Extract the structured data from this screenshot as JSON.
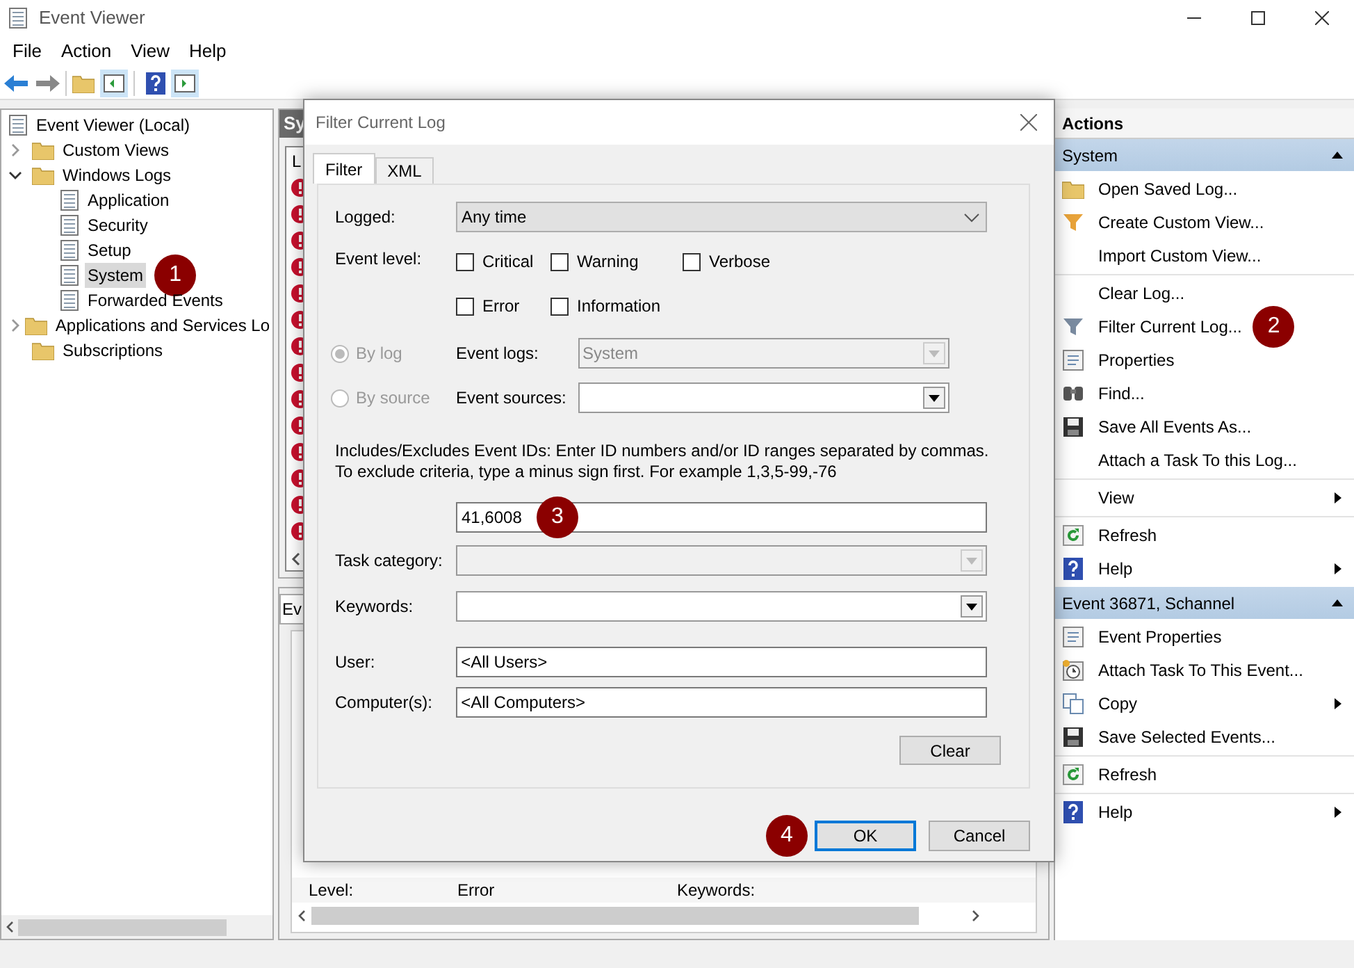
{
  "window": {
    "title": "Event Viewer"
  },
  "menu": [
    "File",
    "Action",
    "View",
    "Help"
  ],
  "tree": [
    {
      "label": "Event Viewer (Local)",
      "selected": false,
      "children": [
        {
          "label": "Custom Views",
          "expanded": false,
          "selected": false
        },
        {
          "label": "Windows Logs",
          "expanded": true,
          "selected": false,
          "children": [
            {
              "label": "Application",
              "selected": false
            },
            {
              "label": "Security",
              "selected": false
            },
            {
              "label": "Setup",
              "selected": false
            },
            {
              "label": "System",
              "selected": true,
              "badge": "1"
            },
            {
              "label": "Forwarded Events",
              "selected": false
            }
          ]
        },
        {
          "label": "Applications and Services Lo",
          "expanded": false,
          "selected": false
        },
        {
          "label": "Subscriptions",
          "selected": false
        }
      ]
    }
  ],
  "middle_pane": {
    "header": "Sy",
    "column_1": "L",
    "tab": "Ev",
    "details": [
      "Level:",
      "Error",
      "Keywords:"
    ]
  },
  "dialog": {
    "title": "Filter Current Log",
    "tabs": [
      {
        "label": "Filter",
        "selected": true
      },
      {
        "label": "XML",
        "selected": false
      }
    ],
    "logged": {
      "label": "Logged:",
      "value": "Any time"
    },
    "event_level": {
      "label": "Event level:",
      "options": [
        {
          "label": "Critical",
          "checked": false
        },
        {
          "label": "Warning",
          "checked": false
        },
        {
          "label": "Verbose",
          "checked": false
        },
        {
          "label": "Error",
          "checked": false
        },
        {
          "label": "Information",
          "checked": false
        }
      ]
    },
    "scope": [
      {
        "label": "By log",
        "selected": true,
        "field_label": "Event logs:",
        "value": "System",
        "disabled": true
      },
      {
        "label": "By source",
        "selected": false,
        "field_label": "Event sources:",
        "disabled": false
      }
    ],
    "hint": "Includes/Excludes Event IDs: Enter ID numbers and/or ID ranges separated by commas. To exclude criteria, type a minus sign first. For example 1,3,5-99,-76",
    "event_ids": {
      "value": "41,6008",
      "badge": "3"
    },
    "task_category": {
      "label": "Task category:",
      "disabled": true
    },
    "keywords": {
      "label": "Keywords:",
      "disabled": false
    },
    "user": {
      "label": "User:",
      "value": "<All Users>"
    },
    "computers": {
      "label": "Computer(s):",
      "value": "<All Computers>"
    },
    "clear_button": "Clear",
    "buttons": [
      {
        "label": "OK",
        "default": true,
        "badge": "4"
      },
      {
        "label": "Cancel",
        "default": false
      }
    ]
  },
  "actions": {
    "title": "Actions",
    "sections": [
      {
        "title": "System",
        "expanded": true,
        "groups": [
          [
            {
              "label": "Open Saved Log...",
              "submenu": false
            },
            {
              "label": "Create Custom View...",
              "submenu": false
            },
            {
              "label": "Import Custom View...",
              "submenu": false
            }
          ],
          [
            {
              "label": "Clear Log...",
              "submenu": false
            },
            {
              "label": "Filter Current Log...",
              "submenu": false,
              "badge": "2"
            },
            {
              "label": "Properties",
              "submenu": false
            },
            {
              "label": "Find...",
              "submenu": false
            },
            {
              "label": "Save All Events As...",
              "submenu": false
            },
            {
              "label": "Attach a Task To this Log...",
              "submenu": false
            }
          ],
          [
            {
              "label": "View",
              "submenu": true
            }
          ],
          [
            {
              "label": "Refresh",
              "submenu": false
            },
            {
              "label": "Help",
              "submenu": true
            }
          ]
        ]
      },
      {
        "title": "Event 36871, Schannel",
        "expanded": true,
        "groups": [
          [
            {
              "label": "Event Properties",
              "submenu": false
            },
            {
              "label": "Attach Task To This Event...",
              "submenu": false
            },
            {
              "label": "Copy",
              "submenu": true
            },
            {
              "label": "Save Selected Events...",
              "submenu": false
            }
          ],
          [
            {
              "label": "Refresh",
              "submenu": false
            }
          ],
          [
            {
              "label": "Help",
              "submenu": true
            }
          ]
        ]
      }
    ]
  }
}
